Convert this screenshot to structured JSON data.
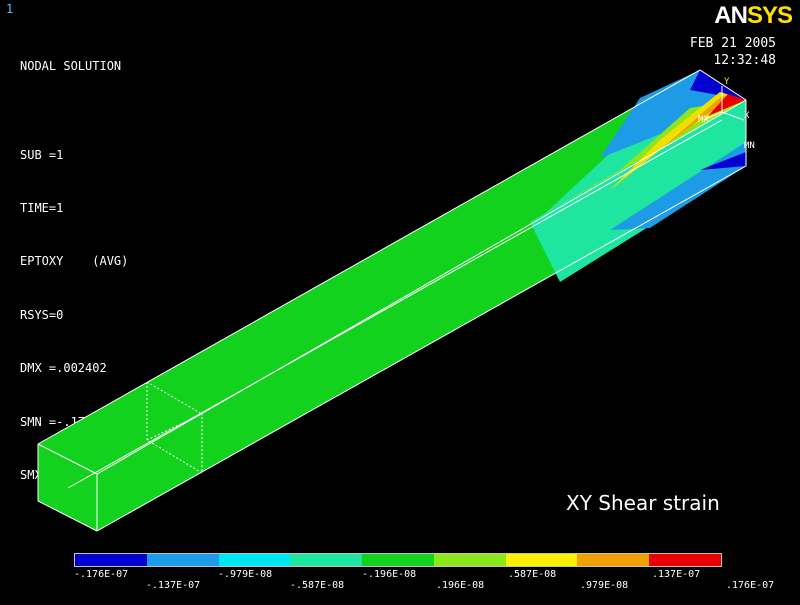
{
  "window_number": "1",
  "info_lines": [
    "NODAL SOLUTION",
    "",
    "SUB =1",
    "TIME=1",
    "EPTOXY    (AVG)",
    "RSYS=0",
    "DMX =.002402",
    "SMN =-.176E-07",
    "SMX =.176E-07"
  ],
  "logo": {
    "part1": "AN",
    "part2": "SYS"
  },
  "date": "FEB 21 2005",
  "time": "12:32:48",
  "caption": "XY Shear strain",
  "triad": {
    "y": "Y",
    "x": "X",
    "mx": "MX",
    "mn": "MN"
  },
  "legend": {
    "colors": [
      "#0000d0",
      "#1e9be6",
      "#00e6f0",
      "#1ee6a0",
      "#12d21e",
      "#8ce61e",
      "#fff000",
      "#f0a000",
      "#e60000"
    ],
    "labels_lower": [
      "-.176E-07",
      "-.979E-08",
      "-.196E-08",
      ".587E-08",
      ".137E-07"
    ],
    "labels_upper": [
      "-.137E-07",
      "-.587E-08",
      ".196E-08",
      ".979E-08",
      ".176E-07"
    ]
  }
}
